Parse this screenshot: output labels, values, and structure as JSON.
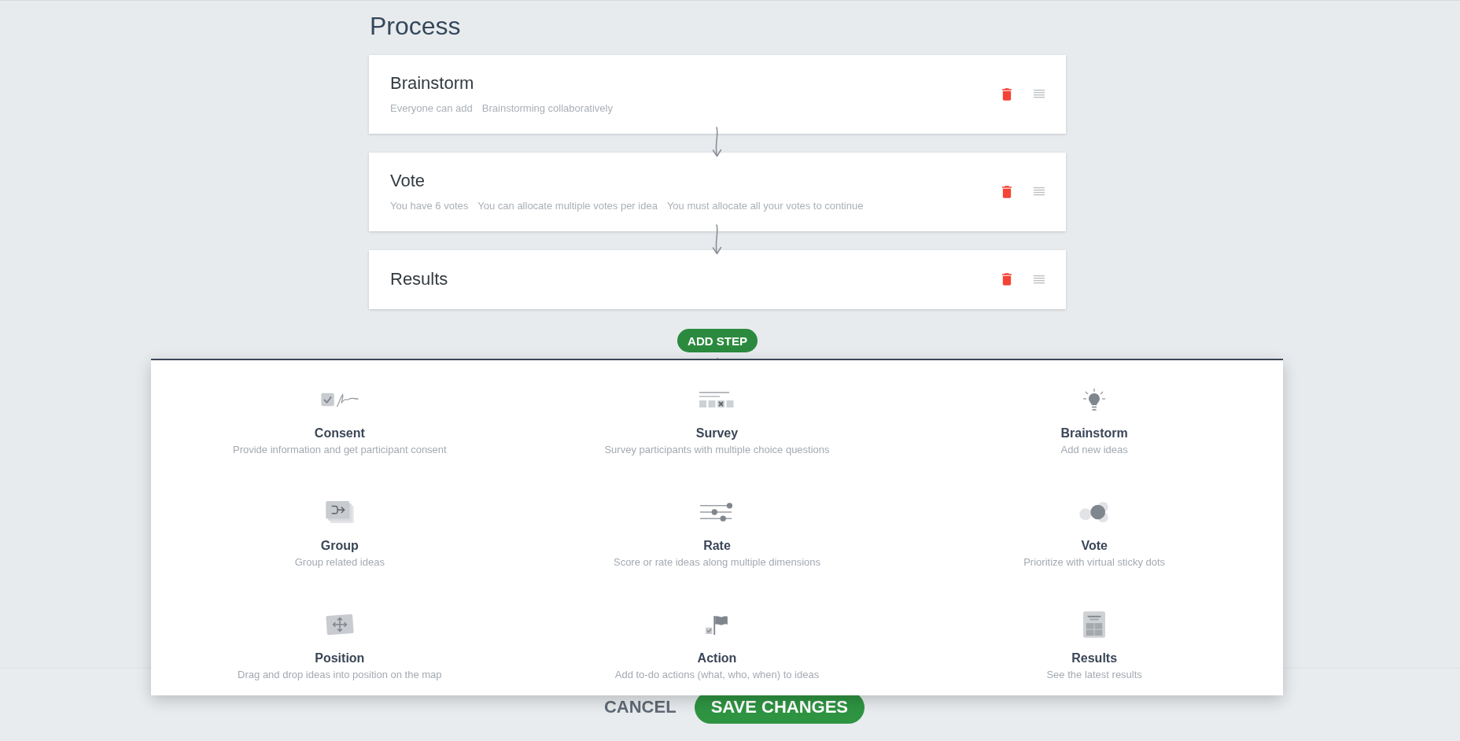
{
  "heading": "Process",
  "steps": [
    {
      "title": "Brainstorm",
      "details": [
        "Everyone can add",
        "Brainstorming collaboratively"
      ]
    },
    {
      "title": "Vote",
      "details": [
        "You have 6 votes",
        "You can allocate multiple votes per idea",
        "You must allocate all your votes to continue"
      ]
    },
    {
      "title": "Results"
    }
  ],
  "add_step_button": "ADD STEP",
  "step_menu": {
    "options": [
      {
        "kind": "consent",
        "title": "Consent",
        "description": "Provide information and get participant consent"
      },
      {
        "kind": "survey",
        "title": "Survey",
        "description": "Survey participants with multiple choice questions"
      },
      {
        "kind": "brainstorm",
        "title": "Brainstorm",
        "description": "Add new ideas"
      },
      {
        "kind": "group",
        "title": "Group",
        "description": "Group related ideas"
      },
      {
        "kind": "rate",
        "title": "Rate",
        "description": "Score or rate ideas along multiple dimensions"
      },
      {
        "kind": "vote",
        "title": "Vote",
        "description": "Prioritize with virtual sticky dots"
      },
      {
        "kind": "position",
        "title": "Position",
        "description": "Drag and drop ideas into position on the map"
      },
      {
        "kind": "action",
        "title": "Action",
        "description": "Add to-do actions (what, who, when) to ideas"
      },
      {
        "kind": "results",
        "title": "Results",
        "description": "See the latest results"
      }
    ]
  },
  "footer": {
    "cancel_button": "CANCEL",
    "save_button": "SAVE CHANGES"
  }
}
